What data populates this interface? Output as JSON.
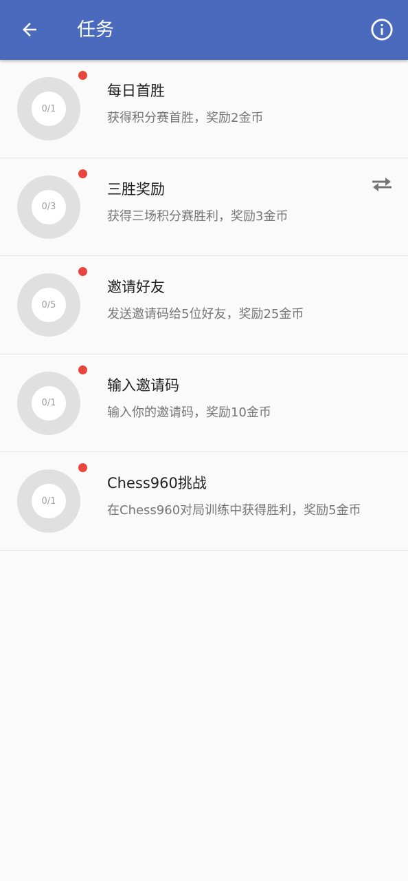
{
  "header": {
    "title": "任务",
    "back_icon": "arrow-left-icon",
    "info_icon": "info-circle-icon",
    "background_color": "#4a6bbd"
  },
  "tasks": [
    {
      "name": "每日首胜",
      "description": "获得积分赛首胜，奖励2金币",
      "progress": "0/1",
      "unread": true
    },
    {
      "name": "三胜奖励",
      "description": "获得三场积分赛胜利，奖励3金币",
      "progress": "0/3",
      "unread": true,
      "action_icon": "swap-arrows-icon"
    },
    {
      "name": "邀请好友",
      "description": "发送邀请码给5位好友，奖励25金币",
      "progress": "0/5",
      "unread": true
    },
    {
      "name": "输入邀请码",
      "description": "输入你的邀请码，奖励10金币",
      "progress": "0/1",
      "unread": true
    },
    {
      "name": "Chess960挑战",
      "description": "在Chess960对局训练中获得胜利，奖励5金币",
      "progress": "0/1",
      "unread": true
    }
  ],
  "colors": {
    "unread_dot": "#e8453c",
    "progress_ring": "#e0e0e0"
  }
}
